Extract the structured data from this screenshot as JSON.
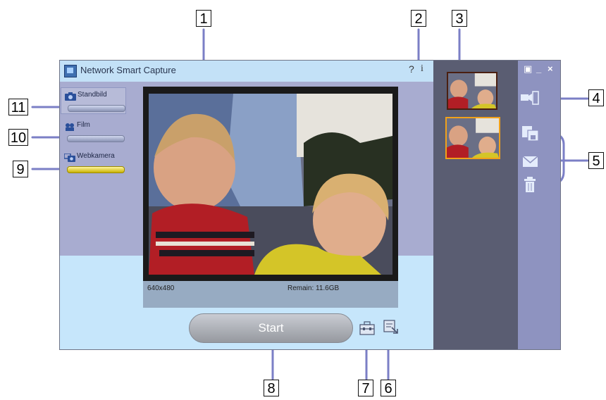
{
  "window": {
    "title": "Network Smart Capture",
    "help_label": "?",
    "info_label": "i",
    "minimize_label": "_",
    "close_label": "×",
    "dock_label": "▣"
  },
  "modes": [
    {
      "label": "Standbild",
      "icon": "camera-icon"
    },
    {
      "label": "Film",
      "icon": "film-icon"
    },
    {
      "label": "Webkamera",
      "icon": "webcam-icon"
    }
  ],
  "preview": {
    "resolution": "640x480",
    "remain": "Remain: 11.6GB"
  },
  "start_label": "Start",
  "right_icons": [
    "camera-export-icon",
    "save-icon",
    "mail-icon",
    "trash-icon"
  ],
  "bottom_icons": [
    "toolbox-icon",
    "settings-icon"
  ],
  "callouts": {
    "c1": "1",
    "c2": "2",
    "c3": "3",
    "c4": "4",
    "c5": "5",
    "c6": "6",
    "c7": "7",
    "c8": "8",
    "c9": "9",
    "c10": "10",
    "c11": "11"
  },
  "colors": {
    "window_bg": "#c6e6fb",
    "main_panel": "#a8acd0",
    "thumb_panel": "#5a5d72",
    "right_panel": "#8e93c0",
    "selected_thumb_border": "#f1a11a",
    "webcam_bar": "#e5d21c"
  }
}
